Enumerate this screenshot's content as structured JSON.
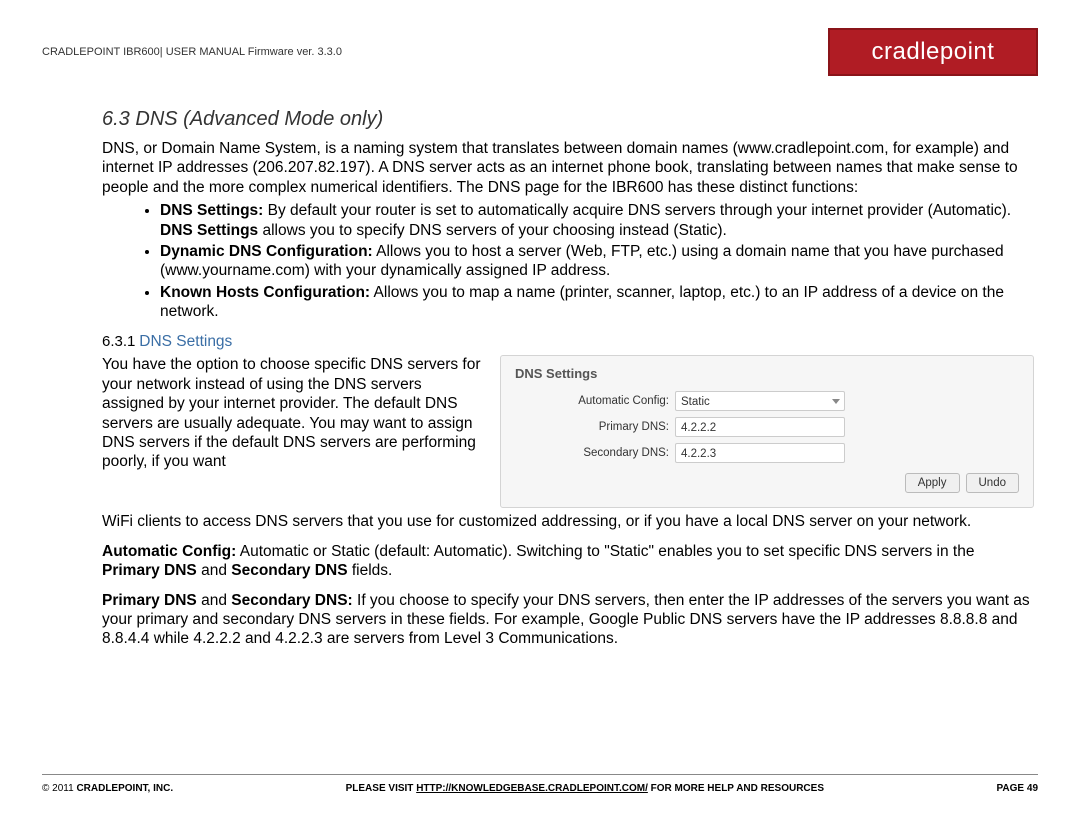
{
  "header": {
    "doc_title": "CRADLEPOINT IBR600| USER MANUAL Firmware ver. 3.3.0",
    "logo": "cradlepoint"
  },
  "section": {
    "number": "6.3",
    "title": "DNS (Advanced Mode only)",
    "intro": "DNS, or Domain Name System, is a naming system that translates between domain names (www.cradlepoint.com, for example) and internet IP addresses (206.207.82.197). A DNS server acts as an internet phone book, translating between names that make sense to people and the more complex numerical identifiers. The DNS page for the IBR600 has these distinct functions:",
    "bullets": [
      {
        "bold": "DNS Settings:",
        "text": " By default your router is set to automatically acquire DNS servers through your internet provider (Automatic). ",
        "bold2": "DNS Settings",
        "text2": " allows you to specify DNS servers of your choosing instead (Static)."
      },
      {
        "bold": "Dynamic DNS Configuration:",
        "text": " Allows you to host a server (Web, FTP, etc.) using a domain name that you have purchased (www.yourname.com) with your dynamically assigned IP address."
      },
      {
        "bold": "Known Hosts Configuration:",
        "text": " Allows you to map a name (printer, scanner, laptop, etc.) to an IP address of a device on the network."
      }
    ]
  },
  "subsection": {
    "number": "6.3.1",
    "title": "DNS Settings",
    "left_para": "You have the option to choose specific DNS servers for your network instead of using the DNS servers assigned by your internet provider. The default DNS servers are usually adequate. You may want to assign DNS servers if the default DNS servers are performing poorly, if you want",
    "continuation": "WiFi clients to access DNS servers that you use for customized addressing, or if you have a local DNS server on your network.",
    "p2_bold": "Automatic Config:",
    "p2_text": " Automatic or Static (default: Automatic). Switching to \"Static\" enables you to set specific DNS servers in the ",
    "p2_bold2": "Primary DNS",
    "p2_text2": " and ",
    "p2_bold3": "Secondary DNS",
    "p2_text3": " fields.",
    "p3_bold1": "Primary DNS",
    "p3_text1": " and ",
    "p3_bold2": "Secondary DNS:",
    "p3_text2": " If you choose to specify your DNS servers, then enter the IP addresses of the servers you want as your primary and secondary DNS servers in these fields. For example, Google Public DNS servers have the IP addresses 8.8.8.8 and 8.8.4.4 while 4.2.2.2 and 4.2.2.3 are servers from Level 3 Communications."
  },
  "panel": {
    "title": "DNS Settings",
    "rows": [
      {
        "label": "Automatic Config:",
        "value": "Static",
        "type": "select"
      },
      {
        "label": "Primary DNS:",
        "value": "4.2.2.2",
        "type": "text"
      },
      {
        "label": "Secondary DNS:",
        "value": "4.2.2.3",
        "type": "text"
      }
    ],
    "buttons": {
      "apply": "Apply",
      "undo": "Undo"
    }
  },
  "footer": {
    "left": "© 2011 ",
    "left_bold": "CRADLEPOINT, INC.",
    "center_pre": "PLEASE VISIT ",
    "center_link": "HTTP://KNOWLEDGEBASE.CRADLEPOINT.COM/",
    "center_post": " FOR MORE HELP AND RESOURCES",
    "right": "PAGE 49"
  }
}
